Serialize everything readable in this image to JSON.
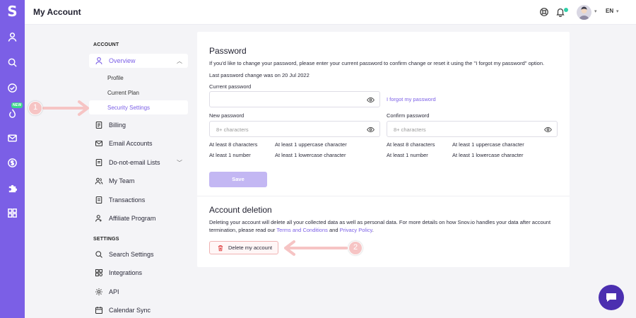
{
  "app": {
    "logo": "S",
    "title": "My Account",
    "lang": "EN",
    "badge_new": "NEW"
  },
  "colors": {
    "accent": "#7b5fe6",
    "rail": "#7b5fe6",
    "danger": "#f0b3b3",
    "annotation": "#f6c4c4"
  },
  "rail_icons": [
    "user-icon",
    "search-icon",
    "check-circle-icon",
    "drip-icon",
    "mail-icon",
    "dollar-icon",
    "puzzle-icon",
    "grid-icon"
  ],
  "menu": {
    "account_title": "ACCOUNT",
    "settings_title": "SETTINGS",
    "overview": "Overview",
    "profile": "Profile",
    "current_plan": "Current Plan",
    "security_settings": "Security Settings",
    "billing": "Billing",
    "email_accounts": "Email Accounts",
    "dnel": "Do-not-email Lists",
    "my_team": "My Team",
    "transactions": "Transactions",
    "affiliate": "Affiliate Program",
    "search_settings": "Search Settings",
    "integrations": "Integrations",
    "api": "API",
    "calendar_sync": "Calendar Sync"
  },
  "password": {
    "title": "Password",
    "desc": "If you'd like to change your password, please enter your current password to confirm change or reset it using the \"I forgot my password\" option.",
    "last_change": "Last password change was on 20 Jul 2022",
    "current_label": "Current password",
    "forgot": "I forgot my password",
    "new_label": "New password",
    "confirm_label": "Confirm password",
    "placeholder": "8+ characters",
    "rules": [
      "At least 8 characters",
      "At least 1 uppercase character",
      "At least 1 number",
      "At least 1 lowercase character"
    ],
    "save": "Save"
  },
  "deletion": {
    "title": "Account deletion",
    "desc_1": "Deleting your account will delete all your collected data as well as personal data. For more details on how Snov.io handles your data after account",
    "desc_2": "termination, please read our ",
    "terms": "Terms and Conditions",
    "and": " and ",
    "privacy": "Privacy Policy",
    "period": ".",
    "button": "Delete my account"
  },
  "annotations": {
    "one": "1",
    "two": "2"
  }
}
